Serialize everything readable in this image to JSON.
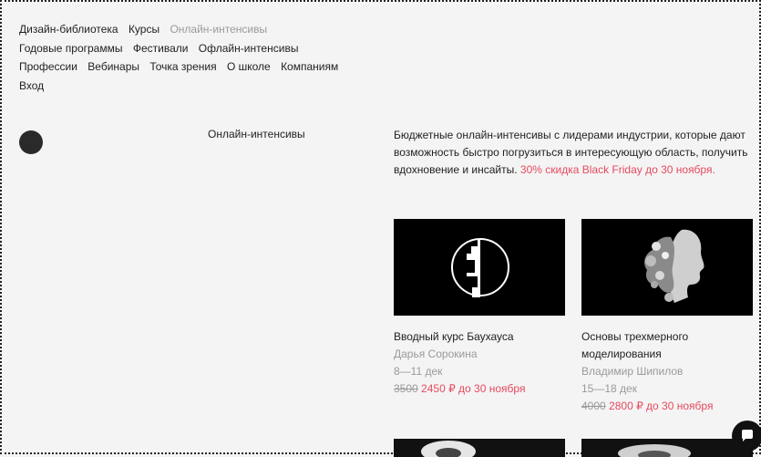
{
  "nav": {
    "row1": [
      "Дизайн-библиотека",
      "Курсы",
      "Онлайн-интенсивы"
    ],
    "row2": [
      "Годовые программы",
      "Фестивали",
      "Офлайн-интенсивы"
    ],
    "row3": [
      "Профессии",
      "Вебинары",
      "Точка зрения",
      "О школе",
      "Компаниям"
    ],
    "row4": [
      "Вход"
    ]
  },
  "section": {
    "title": "Онлайн-интенсивы",
    "description": "Бюджетные онлайн-интенсивы с лидерами индустрии, которые дают возможность быстро погрузиться в интересующую область, получить вдохновение и инсайты.",
    "promo": "30% скидка Black Friday до 30 ноября."
  },
  "cards": [
    {
      "title": "Вводный курс Баухауса",
      "author": "Дарья Сорокина",
      "dates": "8—11 дек",
      "old_price": "3500",
      "new_price": "2450 ₽ до 30 ноября",
      "thumb_icon": "bauhaus-logo-icon"
    },
    {
      "title": "Основы трехмерного моделирования",
      "author": "Владимир Шипилов",
      "dates": "15—18 дек",
      "old_price": "4000",
      "new_price": "2800 ₽ до 30 ноября",
      "thumb_icon": "profile-sculpture-image"
    }
  ],
  "colors": {
    "accent": "#e64a5f",
    "muted": "#9a9a9a",
    "background": "#f4f4f4"
  }
}
